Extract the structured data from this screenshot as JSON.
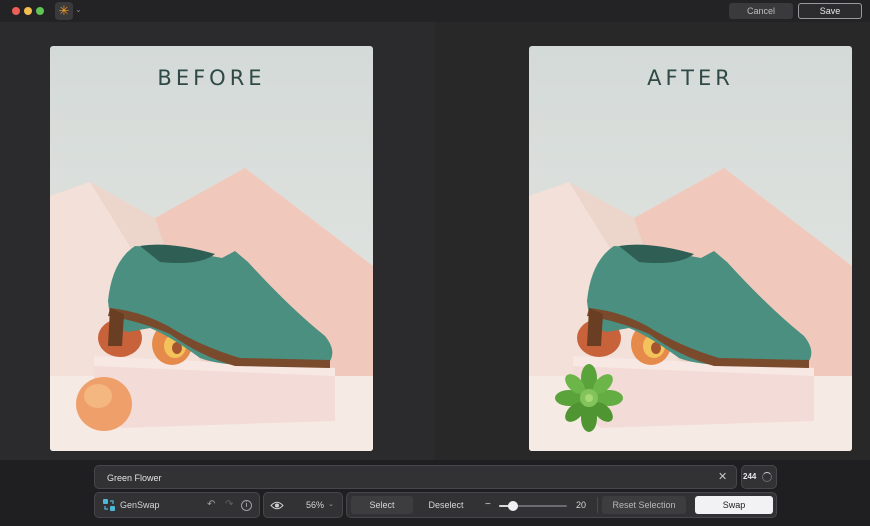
{
  "window": {
    "app_icon": "sparkle-icon",
    "cancel_label": "Cancel",
    "save_label": "Save"
  },
  "comparison": {
    "before_label": "BEFORE",
    "after_label": "AFTER"
  },
  "prompt": {
    "value": "Green Flower",
    "clear_icon": "close-icon"
  },
  "credits": {
    "count": "244"
  },
  "tool": {
    "name": "GenSwap",
    "icon": "genswap-icon"
  },
  "view": {
    "zoom": "56%"
  },
  "selection": {
    "select_label": "Select",
    "deselect_label": "Deselect",
    "brush_size": "20",
    "brush_level": 0.2,
    "reset_label": "Reset Selection",
    "swap_label": "Swap"
  },
  "colors": {
    "accent": "#f59b1f",
    "shoe": "#4a8f80",
    "flower": "#5aa23a"
  }
}
